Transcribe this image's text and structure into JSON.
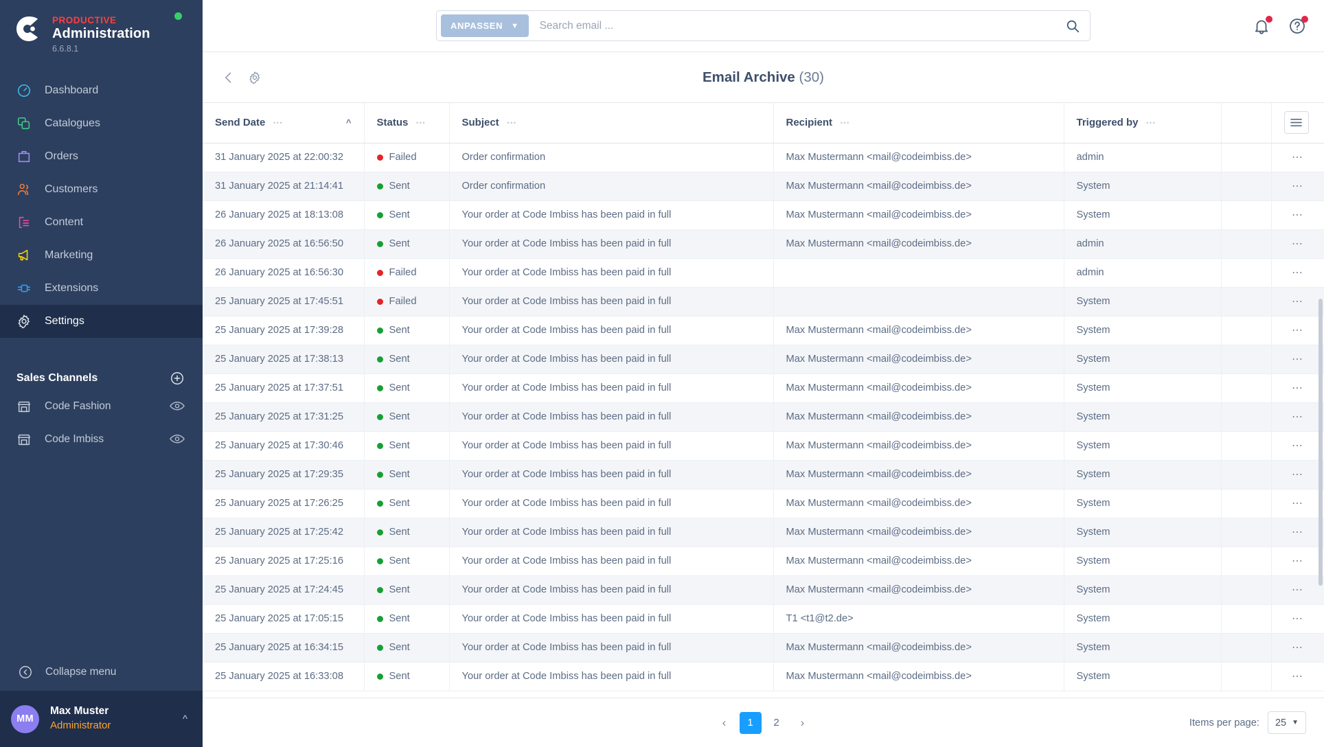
{
  "sidebar": {
    "brand": {
      "top": "PRODUCTIVE",
      "name": "Administration",
      "version": "6.6.8.1",
      "status_color": "#37d067"
    },
    "nav": [
      {
        "label": "Dashboard",
        "icon": "dashboard-icon",
        "color": "#3fb9e8",
        "active": false
      },
      {
        "label": "Catalogues",
        "icon": "catalogues-icon",
        "color": "#41c98b",
        "active": false
      },
      {
        "label": "Orders",
        "icon": "orders-icon",
        "color": "#a48bf0",
        "active": false
      },
      {
        "label": "Customers",
        "icon": "customers-icon",
        "color": "#f0793d",
        "active": false
      },
      {
        "label": "Content",
        "icon": "content-icon",
        "color": "#ed4d9c",
        "active": false
      },
      {
        "label": "Marketing",
        "icon": "marketing-icon",
        "color": "#ffd500",
        "active": false
      },
      {
        "label": "Extensions",
        "icon": "extensions-icon",
        "color": "#2a9fff",
        "active": false
      },
      {
        "label": "Settings",
        "icon": "gear-icon",
        "color": "#c2cbd9",
        "active": true
      }
    ],
    "sales_channels": {
      "title": "Sales Channels",
      "items": [
        {
          "label": "Code Fashion",
          "icon": "storefront-icon"
        },
        {
          "label": "Code Imbiss",
          "icon": "storefront-icon"
        }
      ]
    },
    "collapse_label": "Collapse menu",
    "user": {
      "initials": "MM",
      "name": "Max Muster",
      "role": "Administrator",
      "avatar_color": "#8b7ef0",
      "role_color": "#ffa531"
    }
  },
  "topbar": {
    "customize_label": "ANPASSEN",
    "search_placeholder": "Search email ...",
    "search_value": "",
    "notification_badge": true,
    "help_badge": true,
    "accent": "#a8c0dd"
  },
  "page": {
    "title": "Email Archive",
    "count": "(30)"
  },
  "table": {
    "columns": [
      {
        "label": "Send Date",
        "sortable": true,
        "sort": "asc"
      },
      {
        "label": "Status",
        "sortable": false
      },
      {
        "label": "Subject",
        "sortable": false
      },
      {
        "label": "Recipient",
        "sortable": false
      },
      {
        "label": "Triggered by",
        "sortable": false
      }
    ],
    "row_menu_glyph": "⋯",
    "rows": [
      {
        "date": "31 January 2025 at 22:00:32",
        "status": "Failed",
        "subject": "Order confirmation",
        "recipient": "Max Mustermann <mail@codeimbiss.de>",
        "trigger": "admin"
      },
      {
        "date": "31 January 2025 at 21:14:41",
        "status": "Sent",
        "subject": "Order confirmation",
        "recipient": "Max Mustermann <mail@codeimbiss.de>",
        "trigger": "System"
      },
      {
        "date": "26 January 2025 at 18:13:08",
        "status": "Sent",
        "subject": "Your order at Code Imbiss has been paid in full",
        "recipient": "Max Mustermann <mail@codeimbiss.de>",
        "trigger": "System"
      },
      {
        "date": "26 January 2025 at 16:56:50",
        "status": "Sent",
        "subject": "Your order at Code Imbiss has been paid in full",
        "recipient": "Max Mustermann <mail@codeimbiss.de>",
        "trigger": "admin"
      },
      {
        "date": "26 January 2025 at 16:56:30",
        "status": "Failed",
        "subject": "Your order at Code Imbiss has been paid in full",
        "recipient": "",
        "trigger": "admin"
      },
      {
        "date": "25 January 2025 at 17:45:51",
        "status": "Failed",
        "subject": "Your order at Code Imbiss has been paid in full",
        "recipient": "",
        "trigger": "System"
      },
      {
        "date": "25 January 2025 at 17:39:28",
        "status": "Sent",
        "subject": "Your order at Code Imbiss has been paid in full",
        "recipient": "Max Mustermann <mail@codeimbiss.de>",
        "trigger": "System"
      },
      {
        "date": "25 January 2025 at 17:38:13",
        "status": "Sent",
        "subject": "Your order at Code Imbiss has been paid in full",
        "recipient": "Max Mustermann <mail@codeimbiss.de>",
        "trigger": "System"
      },
      {
        "date": "25 January 2025 at 17:37:51",
        "status": "Sent",
        "subject": "Your order at Code Imbiss has been paid in full",
        "recipient": "Max Mustermann <mail@codeimbiss.de>",
        "trigger": "System"
      },
      {
        "date": "25 January 2025 at 17:31:25",
        "status": "Sent",
        "subject": "Your order at Code Imbiss has been paid in full",
        "recipient": "Max Mustermann <mail@codeimbiss.de>",
        "trigger": "System"
      },
      {
        "date": "25 January 2025 at 17:30:46",
        "status": "Sent",
        "subject": "Your order at Code Imbiss has been paid in full",
        "recipient": "Max Mustermann <mail@codeimbiss.de>",
        "trigger": "System"
      },
      {
        "date": "25 January 2025 at 17:29:35",
        "status": "Sent",
        "subject": "Your order at Code Imbiss has been paid in full",
        "recipient": "Max Mustermann <mail@codeimbiss.de>",
        "trigger": "System"
      },
      {
        "date": "25 January 2025 at 17:26:25",
        "status": "Sent",
        "subject": "Your order at Code Imbiss has been paid in full",
        "recipient": "Max Mustermann <mail@codeimbiss.de>",
        "trigger": "System"
      },
      {
        "date": "25 January 2025 at 17:25:42",
        "status": "Sent",
        "subject": "Your order at Code Imbiss has been paid in full",
        "recipient": "Max Mustermann <mail@codeimbiss.de>",
        "trigger": "System"
      },
      {
        "date": "25 January 2025 at 17:25:16",
        "status": "Sent",
        "subject": "Your order at Code Imbiss has been paid in full",
        "recipient": "Max Mustermann <mail@codeimbiss.de>",
        "trigger": "System"
      },
      {
        "date": "25 January 2025 at 17:24:45",
        "status": "Sent",
        "subject": "Your order at Code Imbiss has been paid in full",
        "recipient": "Max Mustermann <mail@codeimbiss.de>",
        "trigger": "System"
      },
      {
        "date": "25 January 2025 at 17:05:15",
        "status": "Sent",
        "subject": "Your order at Code Imbiss has been paid in full",
        "recipient": "T1 <t1@t2.de>",
        "trigger": "System"
      },
      {
        "date": "25 January 2025 at 16:34:15",
        "status": "Sent",
        "subject": "Your order at Code Imbiss has been paid in full",
        "recipient": "Max Mustermann <mail@codeimbiss.de>",
        "trigger": "System"
      },
      {
        "date": "25 January 2025 at 16:33:08",
        "status": "Sent",
        "subject": "Your order at Code Imbiss has been paid in full",
        "recipient": "Max Mustermann <mail@codeimbiss.de>",
        "trigger": "System"
      }
    ],
    "status_colors": {
      "Sent": "#16a034",
      "Failed": "#e52427"
    }
  },
  "footer": {
    "prev": "‹",
    "next": "›",
    "pages": [
      "1",
      "2"
    ],
    "current_page": "1",
    "items_per_page_label": "Items per page:",
    "items_per_page_value": "25",
    "active_color": "#189eff"
  }
}
